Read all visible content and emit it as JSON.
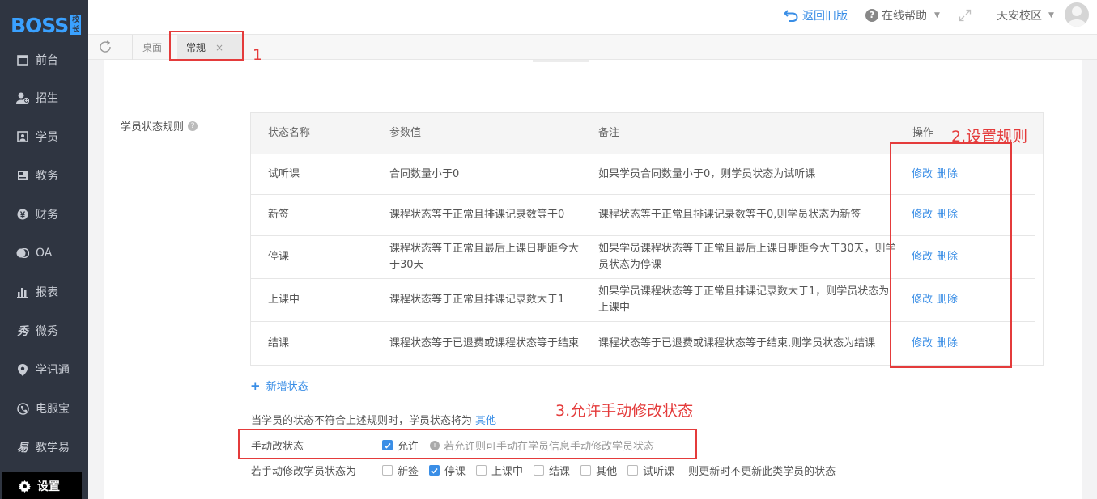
{
  "brand": {
    "logo_text": "BOSS",
    "logo_badge": "校长"
  },
  "sidebar": {
    "items": [
      {
        "label": "前台",
        "icon": "front-desk-icon"
      },
      {
        "label": "招生",
        "icon": "enroll-icon"
      },
      {
        "label": "学员",
        "icon": "student-icon"
      },
      {
        "label": "教务",
        "icon": "academic-icon"
      },
      {
        "label": "财务",
        "icon": "finance-icon"
      },
      {
        "label": "OA",
        "icon": "oa-icon"
      },
      {
        "label": "报表",
        "icon": "report-icon"
      },
      {
        "label": "微秀",
        "icon": "weixiu-icon"
      },
      {
        "label": "学讯通",
        "icon": "location-icon"
      },
      {
        "label": "电服宝",
        "icon": "phone-icon"
      },
      {
        "label": "教学易",
        "icon": "teaching-icon"
      },
      {
        "label": "设置",
        "icon": "gear-icon"
      }
    ]
  },
  "header": {
    "back_label": "返回旧版",
    "help_label": "在线帮助",
    "campus_label": "天安校区"
  },
  "tabs": {
    "home": "桌面",
    "active": "常规",
    "close": "×"
  },
  "rules": {
    "label": "学员状态规则",
    "columns": [
      "状态名称",
      "参数值",
      "备注",
      "操作"
    ],
    "rows": [
      {
        "name": "试听课",
        "param": "合同数量小于0",
        "note": "如果学员合同数量小于0，则学员状态为试听课"
      },
      {
        "name": "新签",
        "param": "课程状态等于正常且排课记录数等于0",
        "note": "课程状态等于正常且排课记录数等于0,则学员状态为新签"
      },
      {
        "name": "停课",
        "param": "课程状态等于正常且最后上课日期距今大于30天",
        "note": "如果学员课程状态等于正常且最后上课日期距今大于30天，则学员状态为停课"
      },
      {
        "name": "上课中",
        "param": "课程状态等于正常且排课记录数大于1",
        "note": "如果学员课程状态等于正常且排课记录数大于1，则学员状态为上课中"
      },
      {
        "name": "结课",
        "param": "课程状态等于已退费或课程状态等于结束",
        "note": "课程状态等于已退费或课程状态等于结束,则学员状态为结课"
      }
    ],
    "edit_label": "修改",
    "delete_label": "删除",
    "add_label": "新增状态"
  },
  "fallback": {
    "text": "当学员的状态不符合上述规则时，学员状态将为",
    "link": "其他"
  },
  "manual": {
    "label": "手动改状态",
    "allow_label": "允许",
    "allow_checked": true,
    "hint": "若允许则可手动在学员信息手动修改学员状态"
  },
  "manual_states": {
    "label": "若手动修改学员状态为",
    "options": [
      {
        "label": "新签",
        "checked": false
      },
      {
        "label": "停课",
        "checked": true
      },
      {
        "label": "上课中",
        "checked": false
      },
      {
        "label": "结课",
        "checked": false
      },
      {
        "label": "其他",
        "checked": false
      },
      {
        "label": "试听课",
        "checked": false
      }
    ],
    "suffix": "则更新时不更新此类学员的状态"
  },
  "annotations": {
    "a1": "1",
    "a2": "2.设置规则",
    "a3": "3.允许手动修改状态"
  },
  "colors": {
    "sidebar_bg": "#2f3541",
    "accent": "#3a8ee6",
    "annotation_red": "#e43b3b"
  }
}
